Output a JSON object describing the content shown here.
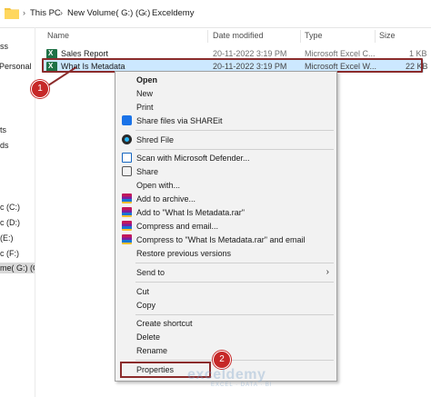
{
  "addressbar": {
    "crumbs": [
      "This PC",
      "New Volume( G:) (G:)",
      "Exceldemy"
    ]
  },
  "nav": {
    "items": [
      "ss",
      "Personal",
      "ts",
      "ds",
      "c (C:)",
      "c (D:)",
      "(E:)",
      "c (F:)",
      "me( G:) (G"
    ]
  },
  "columns": {
    "name": "Name",
    "date": "Date modified",
    "type": "Type",
    "size": "Size"
  },
  "files": [
    {
      "name": "Sales Report",
      "date": "20-11-2022 3:19 PM",
      "type": "Microsoft Excel C...",
      "size": "1 KB"
    },
    {
      "name": "What Is Metadata",
      "date": "20-11-2022 3:19 PM",
      "type": "Microsoft Excel W...",
      "size": "22 KB"
    }
  ],
  "context_menu": {
    "open": "Open",
    "new": "New",
    "print": "Print",
    "shareit": "Share files via SHAREit",
    "shred": "Shred File",
    "defender": "Scan with Microsoft Defender...",
    "share": "Share",
    "open_with": "Open with...",
    "add_archive": "Add to archive...",
    "add_rar": "Add to \"What Is Metadata.rar\"",
    "compress_email": "Compress and email...",
    "compress_rar_email": "Compress to \"What Is Metadata.rar\" and email",
    "restore": "Restore previous versions",
    "send_to": "Send to",
    "cut": "Cut",
    "copy": "Copy",
    "create_shortcut": "Create shortcut",
    "delete": "Delete",
    "rename": "Rename",
    "properties": "Properties"
  },
  "annotations": {
    "badge1": "1",
    "badge2": "2"
  },
  "watermark": {
    "title": "exceldemy",
    "subtitle": "EXCEL · DATA · BI"
  },
  "colors": {
    "highlight": "#cce8ff",
    "annotation": "#8b2b2b",
    "badge": "#c62828"
  }
}
